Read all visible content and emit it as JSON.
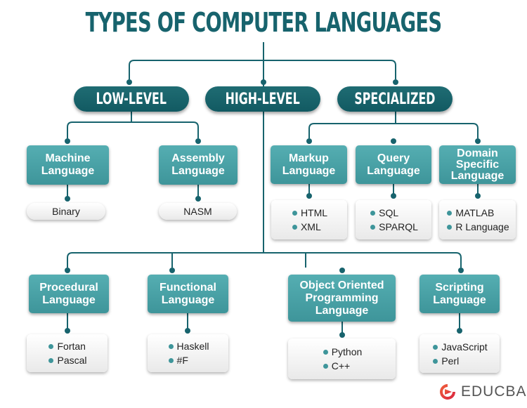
{
  "title": "TYPES OF COMPUTER LANGUAGES",
  "colors": {
    "dark_teal": "#17636d",
    "box_teal": "#4aa3a8",
    "line": "#17636d",
    "logo_red": "#e5473b"
  },
  "categories": [
    {
      "label": "LOW-LEVEL"
    },
    {
      "label": "HIGH-LEVEL"
    },
    {
      "label": "SPECIALIZED"
    }
  ],
  "low_level": [
    {
      "label": "Machine\nLanguage",
      "examples": [
        "Binary"
      ]
    },
    {
      "label": "Assembly\nLanguage",
      "examples": [
        "NASM"
      ]
    }
  ],
  "specialized": [
    {
      "label": "Markup\nLanguage",
      "examples": [
        "HTML",
        "XML"
      ]
    },
    {
      "label": "Query\nLanguage",
      "examples": [
        "SQL",
        "SPARQL"
      ]
    },
    {
      "label": "Domain\nSpecific\nLanguage",
      "examples": [
        "MATLAB",
        "R Language"
      ]
    }
  ],
  "high_level": [
    {
      "label": "Procedural\nLanguage",
      "examples": [
        "Fortan",
        "Pascal"
      ]
    },
    {
      "label": "Functional\nLanguage",
      "examples": [
        "Haskell",
        "#F"
      ]
    },
    {
      "label": "Object Oriented\nProgramming\nLanguage",
      "examples": [
        "Python",
        "C++"
      ]
    },
    {
      "label": "Scripting\nLanguage",
      "examples": [
        "JavaScript",
        "Perl"
      ]
    }
  ],
  "logo": {
    "text": "EDUCBA",
    "icon": "educba-logo-icon"
  }
}
